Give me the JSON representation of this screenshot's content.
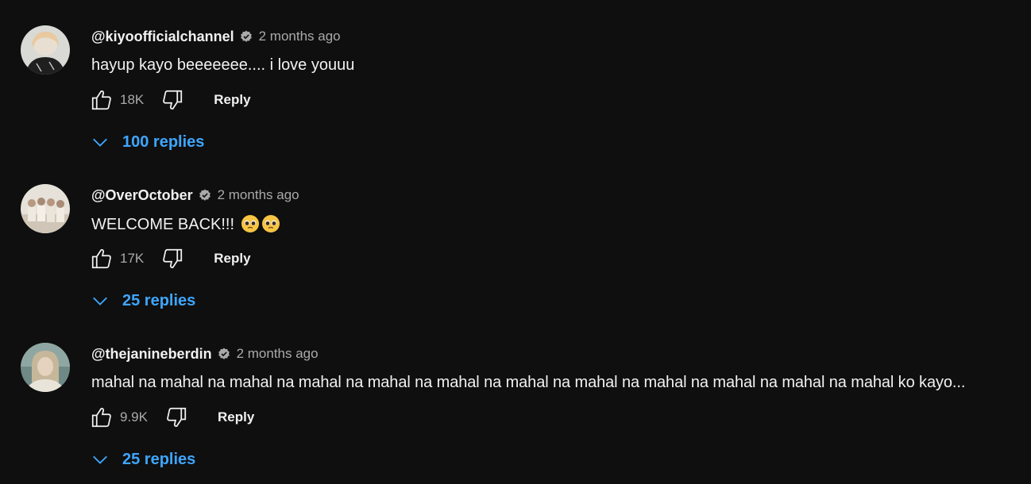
{
  "comments": [
    {
      "author": "@kiyoofficialchannel",
      "time": "2 months ago",
      "text": "hayup kayo beeeeeee.... i love youuu",
      "likes": "18K",
      "reply_label": "Reply",
      "replies_label": "100 replies",
      "avatar_icon": "avatar-photo-icon"
    },
    {
      "author": "@OverOctober",
      "time": "2 months ago",
      "text": "WELCOME BACK!!! ",
      "emoji": "pleading-face-emoji x2",
      "likes": "17K",
      "reply_label": "Reply",
      "replies_label": "25 replies",
      "avatar_icon": "avatar-photo-icon"
    },
    {
      "author": "@thejanineberdin",
      "time": "2 months ago",
      "text": "mahal na mahal na mahal na mahal na mahal na mahal na mahal na mahal na mahal na mahal na mahal na mahal ko kayo...",
      "likes": "9.9K",
      "reply_label": "Reply",
      "replies_label": "25 replies",
      "avatar_icon": "avatar-photo-icon"
    }
  ],
  "colors": {
    "background": "#0f0f0f",
    "primary_text": "#f1f1f1",
    "secondary_text": "#aaaaaa",
    "link_blue": "#3ea6ff"
  },
  "icons": {
    "verified": "verified-badge-icon",
    "like": "thumbs-up-icon",
    "dislike": "thumbs-down-icon",
    "expand": "chevron-down-icon"
  }
}
